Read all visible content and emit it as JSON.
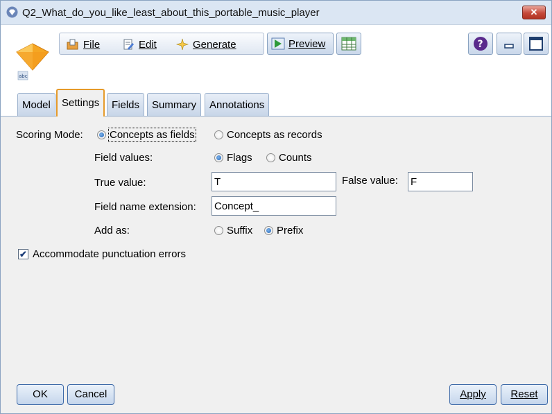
{
  "window": {
    "title": "Q2_What_do_you_like_least_about_this_portable_music_player",
    "close_icon": "close-x-icon",
    "accent_color": "#e59a2a",
    "close_color": "#c5493a"
  },
  "menu": {
    "file_label": "File",
    "edit_label": "Edit",
    "generate_label": "Generate",
    "preview_label": "Preview"
  },
  "node": {
    "icon": "text-mining-model-icon",
    "caption": "abc"
  },
  "tabs": [
    {
      "label": "Model"
    },
    {
      "label": "Settings"
    },
    {
      "label": "Fields"
    },
    {
      "label": "Summary"
    },
    {
      "label": "Annotations"
    }
  ],
  "active_tab": "Settings",
  "settings": {
    "scoring_mode_label": "Scoring Mode:",
    "scoring_mode_options": [
      {
        "label": "Concepts as fields",
        "selected": true
      },
      {
        "label": "Concepts as records",
        "selected": false
      }
    ],
    "field_values_label": "Field values:",
    "field_values_options": [
      {
        "label": "Flags",
        "selected": true
      },
      {
        "label": "Counts",
        "selected": false
      }
    ],
    "true_value_label": "True value:",
    "true_value": "T",
    "false_value_label": "False value:",
    "false_value": "F",
    "field_name_ext_label": "Field name extension:",
    "field_name_ext_value": "Concept_",
    "add_as_label": "Add as:",
    "add_as_options": [
      {
        "label": "Suffix",
        "selected": false
      },
      {
        "label": "Prefix",
        "selected": true
      }
    ],
    "punctuation_label": "Accommodate punctuation errors",
    "punctuation_checked": true
  },
  "buttons": {
    "ok": "OK",
    "cancel": "Cancel",
    "apply": "Apply",
    "reset": "Reset"
  }
}
